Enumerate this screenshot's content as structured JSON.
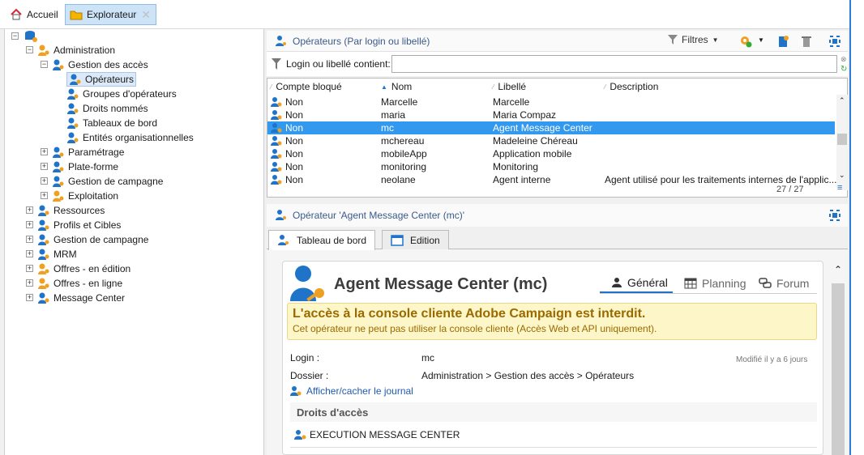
{
  "tabs": {
    "home": "Accueil",
    "explorer": "Explorateur"
  },
  "tree": {
    "root_expander": "−",
    "nodes": [
      {
        "label": "Administration",
        "exp": "−"
      },
      {
        "label": "Gestion des accès",
        "exp": "−"
      },
      {
        "label": "Opérateurs"
      },
      {
        "label": "Groupes d'opérateurs"
      },
      {
        "label": "Droits nommés"
      },
      {
        "label": "Tableaux de bord"
      },
      {
        "label": "Entités organisationnelles"
      },
      {
        "label": "Paramétrage",
        "exp": "+"
      },
      {
        "label": "Plate-forme",
        "exp": "+"
      },
      {
        "label": "Gestion de campagne",
        "exp": "+"
      },
      {
        "label": "Exploitation",
        "exp": "+"
      },
      {
        "label": "Ressources",
        "exp": "+"
      },
      {
        "label": "Profils et Cibles",
        "exp": "+"
      },
      {
        "label": "Gestion de campagne",
        "exp": "+"
      },
      {
        "label": "MRM",
        "exp": "+"
      },
      {
        "label": "Offres - en édition",
        "exp": "+"
      },
      {
        "label": "Offres - en ligne",
        "exp": "+"
      },
      {
        "label": "Message Center",
        "exp": "+"
      }
    ]
  },
  "list": {
    "title": "Opérateurs (Par login ou libellé)",
    "filters_label": "Filtres",
    "filter_label": "Login ou libellé contient:",
    "filter_value": "",
    "columns": [
      "Compte bloqué",
      "Nom",
      "Libellé",
      "Description"
    ],
    "rows": [
      {
        "blocked": "Non",
        "name": "Marcelle",
        "label": "Marcelle",
        "desc": ""
      },
      {
        "blocked": "Non",
        "name": "maria",
        "label": "Maria Compaz",
        "desc": ""
      },
      {
        "blocked": "Non",
        "name": "mc",
        "label": "Agent Message Center",
        "desc": ""
      },
      {
        "blocked": "Non",
        "name": "mchereau",
        "label": "Madeleine Chéreau",
        "desc": ""
      },
      {
        "blocked": "Non",
        "name": "mobileApp",
        "label": "Application mobile",
        "desc": ""
      },
      {
        "blocked": "Non",
        "name": "monitoring",
        "label": "Monitoring",
        "desc": ""
      },
      {
        "blocked": "Non",
        "name": "neolane",
        "label": "Agent interne",
        "desc": "Agent utilisé pour les traitements internes de l'applic..."
      }
    ],
    "count": "27 / 27"
  },
  "detail": {
    "title": "Opérateur 'Agent Message Center (mc)'",
    "tabs": [
      "Tableau de bord",
      "Edition"
    ],
    "heading": "Agent Message Center (mc)",
    "subtabs": [
      "Général",
      "Planning",
      "Forum"
    ],
    "warning_title": "L'accès à la console cliente Adobe Campaign est interdit.",
    "warning_text": "Cet opérateur ne peut pas utiliser la console cliente (Accès Web et API uniquement).",
    "login_label": "Login :",
    "login_value": "mc",
    "modified": "Modifié il y a 6 jours",
    "folder_label": "Dossier :",
    "folder_value": "Administration > Gestion des accès > Opérateurs",
    "journal_link": "Afficher/cacher le journal",
    "rights_title": "Droits d'accès",
    "right_item": "EXECUTION MESSAGE CENTER"
  },
  "colors": {
    "accent": "#3399ee",
    "icon_blue": "#1f74c9",
    "icon_orange": "#f0a020",
    "warning_text": "#9a6a00"
  }
}
